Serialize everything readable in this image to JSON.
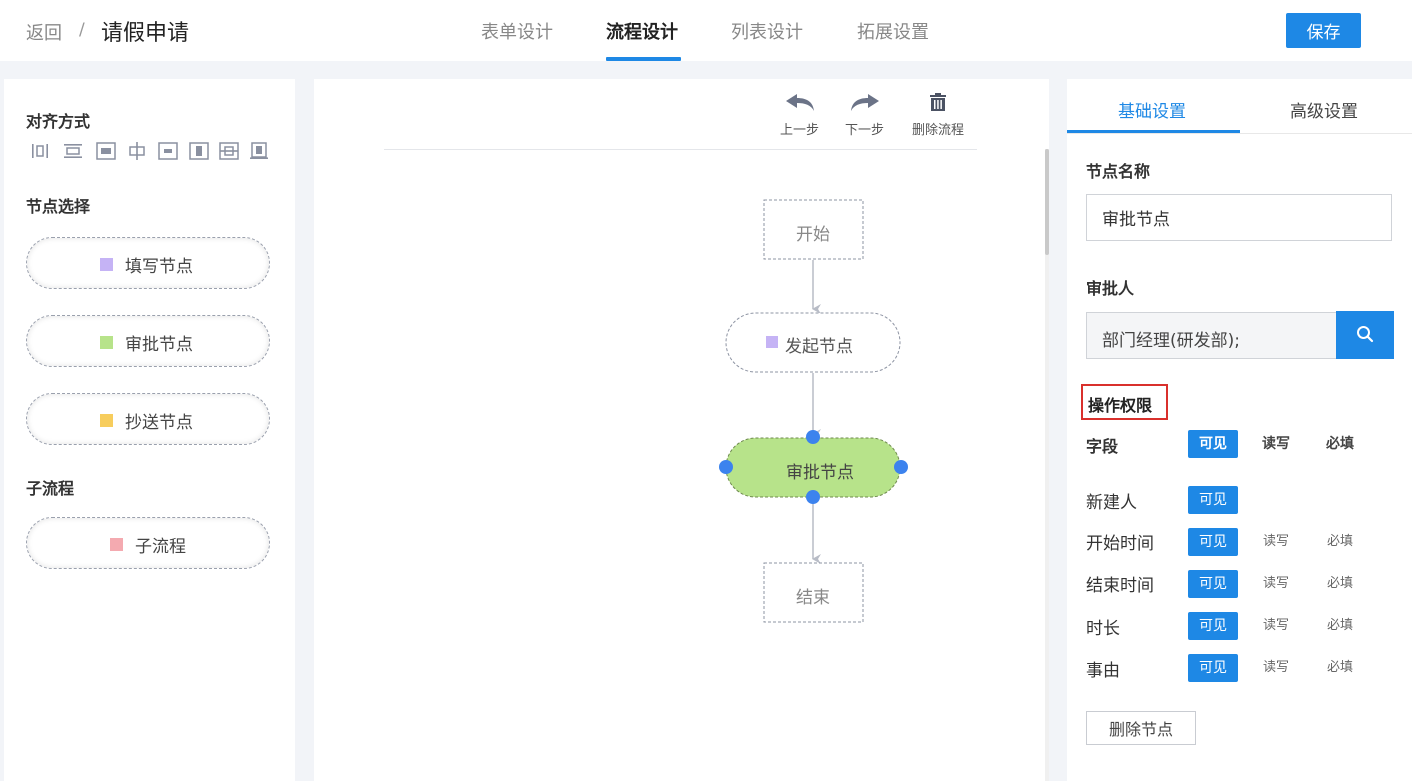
{
  "header": {
    "back_label": "返回",
    "separator": "/",
    "title": "请假申请",
    "tabs": [
      "表单设计",
      "流程设计",
      "列表设计",
      "拓展设置"
    ],
    "active_tab": "流程设计",
    "save_label": "保存"
  },
  "left": {
    "align_title": "对齐方式",
    "align_icons": [
      "align-left-icon",
      "align-horizontal-center-icon",
      "align-right-icon",
      "align-vertical-center-icon",
      "align-middle-icon",
      "align-top-icon",
      "distribute-horizontal-icon",
      "align-bottom-icon"
    ],
    "node_title": "节点选择",
    "nodes": [
      {
        "label": "填写节点",
        "color": "#c5b3f5"
      },
      {
        "label": "审批节点",
        "color": "#b7e38a"
      },
      {
        "label": "抄送节点",
        "color": "#f7cd5d"
      }
    ],
    "subflow_title": "子流程",
    "subflow": {
      "label": "子流程",
      "color": "#f4aab0"
    }
  },
  "canvas": {
    "undo_label": "上一步",
    "redo_label": "下一步",
    "delete_flow_label": "删除流程",
    "flow": {
      "start": "开始",
      "initiate": "发起节点",
      "initiate_color": "#c5b3f5",
      "approve": "审批节点",
      "approve_color": "#b7e38a",
      "end": "结束"
    }
  },
  "right": {
    "tab_basic": "基础设置",
    "tab_advanced": "高级设置",
    "node_name_label": "节点名称",
    "node_name_value": "审批节点",
    "approver_label": "审批人",
    "approver_value": "部门经理(研发部);",
    "perm_title": "操作权限",
    "perm_header": {
      "field": "字段",
      "visible": "可见",
      "rw": "读写",
      "required": "必填"
    },
    "fields": [
      {
        "name": "新建人",
        "visible": "可见"
      },
      {
        "name": "开始时间",
        "visible": "可见",
        "rw": "读写",
        "required": "必填"
      },
      {
        "name": "结束时间",
        "visible": "可见",
        "rw": "读写",
        "required": "必填"
      },
      {
        "name": "时长",
        "visible": "可见",
        "rw": "读写",
        "required": "必填"
      },
      {
        "name": "事由",
        "visible": "可见",
        "rw": "读写",
        "required": "必填"
      }
    ],
    "delete_node_label": "删除节点"
  },
  "colors": {
    "accent": "#1e88e5",
    "highlight": "#d9302c"
  }
}
